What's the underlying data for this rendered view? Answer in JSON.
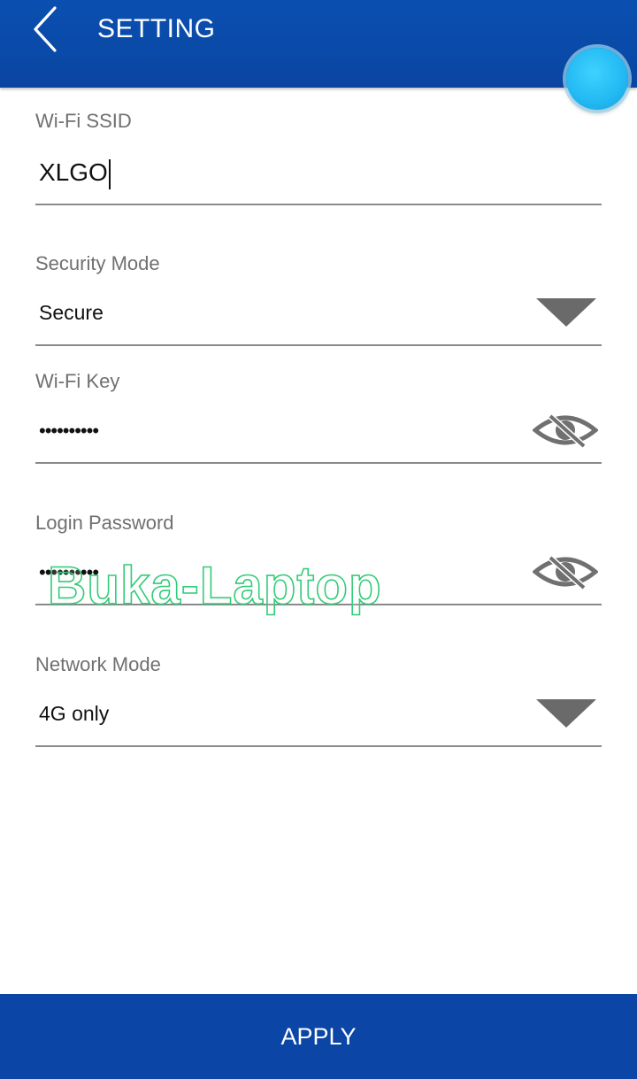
{
  "header": {
    "title": "SETTING",
    "back_icon": "chevron-left-icon",
    "color": "#0a4aa8"
  },
  "fab": {
    "color": "#22b8f2"
  },
  "fields": {
    "ssid": {
      "label": "Wi-Fi SSID",
      "value": "XLGO"
    },
    "security_mode": {
      "label": "Security Mode",
      "value": "Secure",
      "icon": "dropdown-arrow-icon"
    },
    "wifi_key": {
      "label": "Wi-Fi Key",
      "value": "••••••••••",
      "icon": "eye-slash-icon"
    },
    "login_password": {
      "label": "Login Password",
      "value": "••••••••••",
      "icon": "eye-slash-icon"
    },
    "network_mode": {
      "label": "Network Mode",
      "value": "4G only",
      "icon": "dropdown-arrow-icon"
    }
  },
  "watermark": "Buka-Laptop",
  "apply_button": {
    "label": "APPLY",
    "color": "#0b45a5"
  }
}
